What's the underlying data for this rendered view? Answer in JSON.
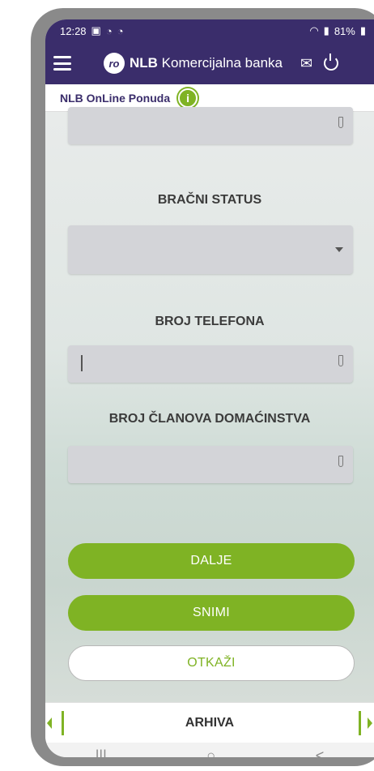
{
  "status_bar": {
    "time": "12:28",
    "battery": "81%"
  },
  "header": {
    "logo_mark": "ro",
    "brand_bold": "NLB",
    "brand_rest": " Komercijalna banka"
  },
  "sub_header": {
    "title": "NLB OnLine Ponuda",
    "info_glyph": "i"
  },
  "form": {
    "marital_status_label": "BRAČNI STATUS",
    "phone_label": "BROJ TELEFONA",
    "household_label": "BROJ ČLANOVA DOMAĆINSTVA"
  },
  "buttons": {
    "next": "DALJE",
    "save": "SNIMI",
    "cancel": "OTKAŽI"
  },
  "bottom_nav": {
    "label": "ARHIVA"
  },
  "system_nav": {
    "recents": "|||",
    "home": "○",
    "back": "<"
  },
  "colors": {
    "brand_purple": "#3a2d6b",
    "accent_green": "#7fb324"
  }
}
